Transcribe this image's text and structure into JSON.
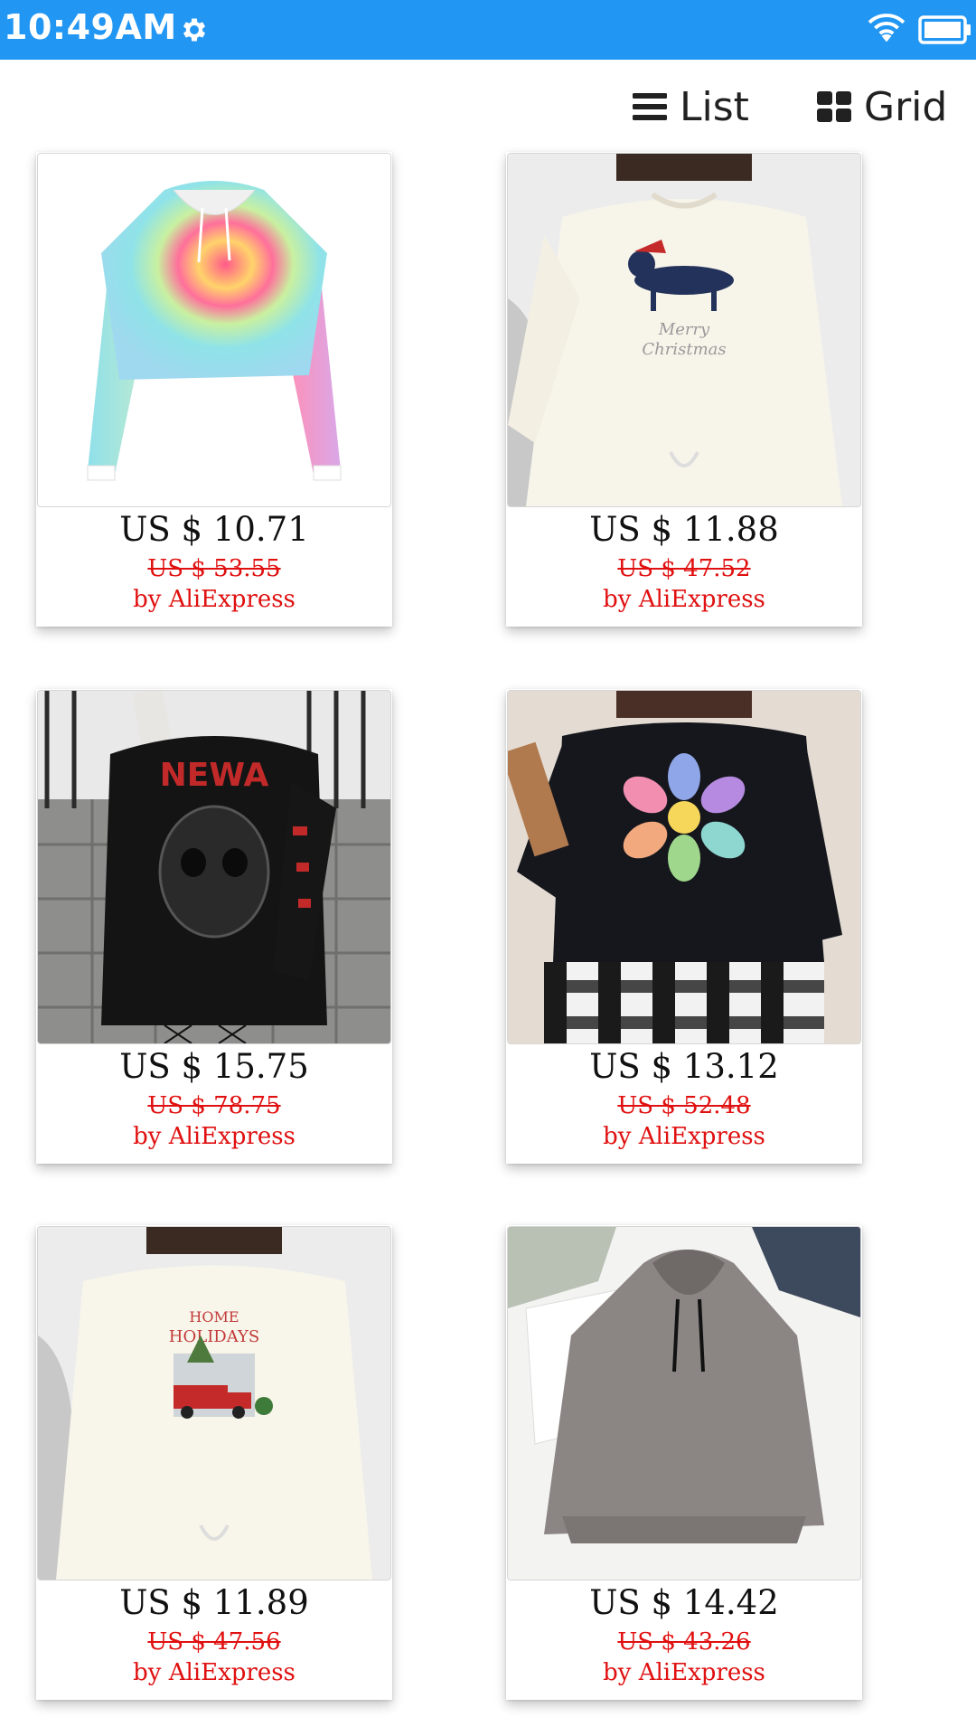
{
  "status_bar": {
    "time": "10:49AM",
    "icons": [
      "settings-gear-icon",
      "wifi-icon",
      "battery-icon"
    ],
    "color": "#2196f3"
  },
  "toolbar": {
    "list_label": "List",
    "grid_label": "Grid"
  },
  "products": [
    {
      "price": "US $ 10.71",
      "old_price": "US $ 53.55",
      "seller": "by AliExpress",
      "image": "tie-dye crop hoodie"
    },
    {
      "price": "US $ 11.88",
      "old_price": "US $ 47.52",
      "seller": "by AliExpress",
      "image": "white sweatshirt with dachshund Merry Christmas print"
    },
    {
      "price": "US $ 15.75",
      "old_price": "US $ 78.75",
      "seller": "by AliExpress",
      "image": "black gothic skull hoodie"
    },
    {
      "price": "US $ 13.12",
      "old_price": "US $ 52.48",
      "seller": "by AliExpress",
      "image": "black sweatshirt with rainbow flower print"
    },
    {
      "price": "US $ 11.89",
      "old_price": "US $ 47.56",
      "seller": "by AliExpress",
      "image": "white sweatshirt Home for the Holidays truck print"
    },
    {
      "price": "US $ 14.42",
      "old_price": "US $ 43.26",
      "seller": "by AliExpress",
      "image": "grey fluffy fleece hoodie"
    }
  ],
  "colors": {
    "accent": "#2196f3",
    "price_red": "#e01010"
  }
}
